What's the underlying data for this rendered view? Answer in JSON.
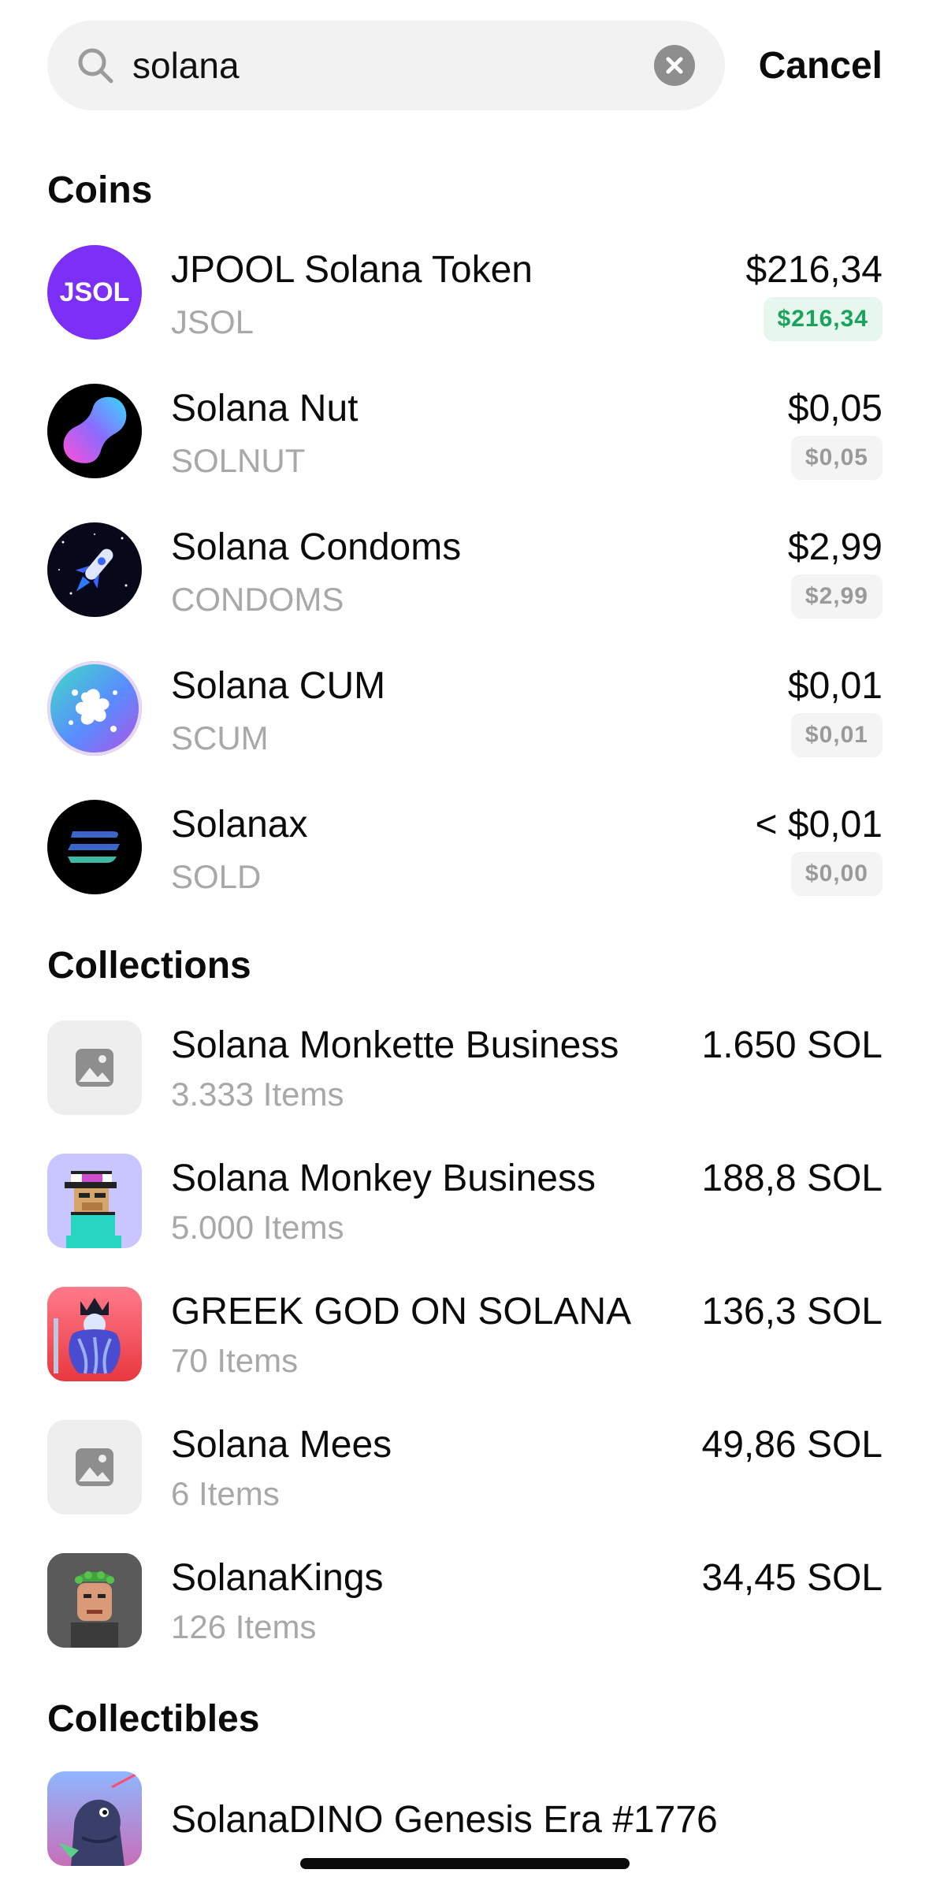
{
  "search": {
    "value": "solana",
    "cancel_label": "Cancel"
  },
  "sections": {
    "coins": "Coins",
    "collections": "Collections",
    "collectibles": "Collectibles"
  },
  "coins": [
    {
      "name": "JPOOL Solana Token",
      "symbol": "JSOL",
      "price": "$216,34",
      "badge": "$216,34",
      "badge_color": "#1aa35c",
      "icon_text": "JSOL",
      "icon_color": "#7b2ff7"
    },
    {
      "name": "Solana Nut",
      "symbol": "SOLNUT",
      "price": "$0,05",
      "badge": "$0,05",
      "badge_color": "#9a9a9a"
    },
    {
      "name": "Solana Condoms",
      "symbol": "CONDOMS",
      "price": "$2,99",
      "badge": "$2,99",
      "badge_color": "#9a9a9a"
    },
    {
      "name": "Solana CUM",
      "symbol": "SCUM",
      "price": "$0,01",
      "badge": "$0,01",
      "badge_color": "#9a9a9a"
    },
    {
      "name": "Solanax",
      "symbol": "SOLD",
      "price": "< $0,01",
      "badge": "$0,00",
      "badge_color": "#9a9a9a"
    }
  ],
  "collections": [
    {
      "name": "Solana Monkette Business",
      "items": "3.333 Items",
      "price": "1.650 SOL",
      "icon": "image-placeholder-icon"
    },
    {
      "name": "Solana Monkey Business",
      "items": "5.000 Items",
      "price": "188,8 SOL",
      "icon": "pixel-monkey-icon"
    },
    {
      "name": "GREEK GOD ON SOLANA",
      "items": "70 Items",
      "price": "136,3 SOL",
      "icon": "greek-god-icon"
    },
    {
      "name": "Solana Mees",
      "items": "6 Items",
      "price": "49,86 SOL",
      "icon": "image-placeholder-icon"
    },
    {
      "name": "SolanaKings",
      "items": "126 Items",
      "price": "34,45 SOL",
      "icon": "king-icon"
    }
  ],
  "collectibles": [
    {
      "name": "SolanaDINO Genesis Era #1776",
      "icon": "dino-icon"
    }
  ]
}
